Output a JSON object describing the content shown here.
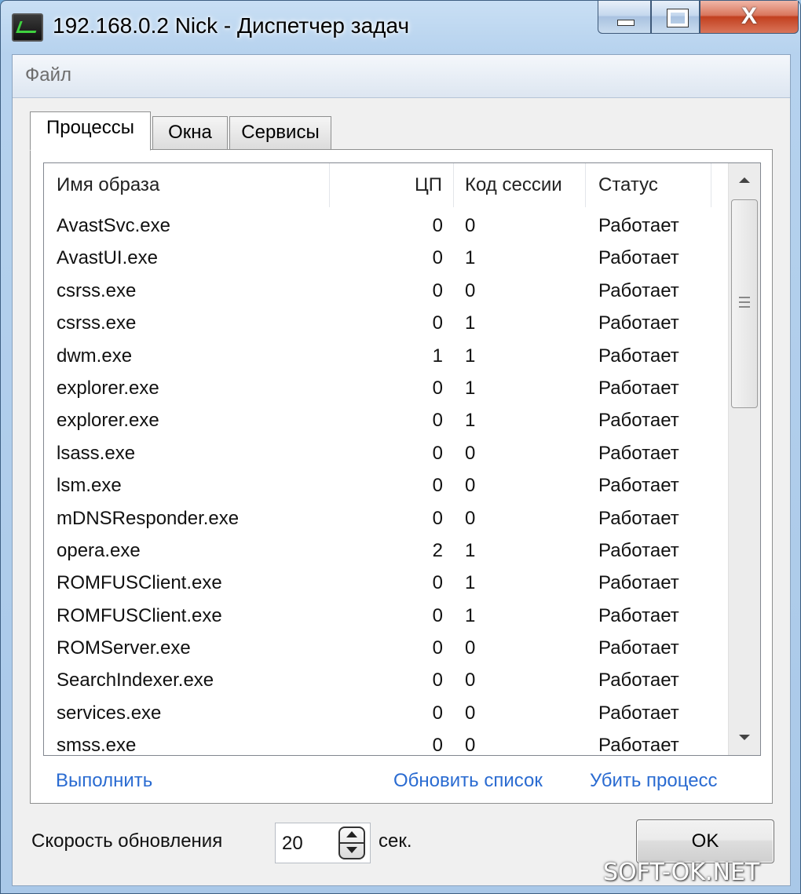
{
  "window": {
    "title": "192.168.0.2 Nick - Диспетчер задач",
    "close_glyph": "X"
  },
  "menu": {
    "file_label": "Файл"
  },
  "tabs": [
    {
      "label": "Процессы",
      "active": true
    },
    {
      "label": "Окна",
      "active": false
    },
    {
      "label": "Сервисы",
      "active": false
    }
  ],
  "table": {
    "columns": [
      "Имя образа",
      "ЦП",
      "Код сессии",
      "Статус"
    ],
    "rows": [
      {
        "name": "AvastSvc.exe",
        "cpu": "0",
        "session": "0",
        "status": "Работает"
      },
      {
        "name": "AvastUI.exe",
        "cpu": "0",
        "session": "1",
        "status": "Работает"
      },
      {
        "name": "csrss.exe",
        "cpu": "0",
        "session": "0",
        "status": "Работает"
      },
      {
        "name": "csrss.exe",
        "cpu": "0",
        "session": "1",
        "status": "Работает"
      },
      {
        "name": "dwm.exe",
        "cpu": "1",
        "session": "1",
        "status": "Работает"
      },
      {
        "name": "explorer.exe",
        "cpu": "0",
        "session": "1",
        "status": "Работает"
      },
      {
        "name": "explorer.exe",
        "cpu": "0",
        "session": "1",
        "status": "Работает"
      },
      {
        "name": "lsass.exe",
        "cpu": "0",
        "session": "0",
        "status": "Работает"
      },
      {
        "name": "lsm.exe",
        "cpu": "0",
        "session": "0",
        "status": "Работает"
      },
      {
        "name": "mDNSResponder.exe",
        "cpu": "0",
        "session": "0",
        "status": "Работает"
      },
      {
        "name": "opera.exe",
        "cpu": "2",
        "session": "1",
        "status": "Работает"
      },
      {
        "name": "ROMFUSClient.exe",
        "cpu": "0",
        "session": "1",
        "status": "Работает"
      },
      {
        "name": "ROMFUSClient.exe",
        "cpu": "0",
        "session": "1",
        "status": "Работает"
      },
      {
        "name": "ROMServer.exe",
        "cpu": "0",
        "session": "0",
        "status": "Работает"
      },
      {
        "name": "SearchIndexer.exe",
        "cpu": "0",
        "session": "0",
        "status": "Работает"
      },
      {
        "name": "services.exe",
        "cpu": "0",
        "session": "0",
        "status": "Работает"
      },
      {
        "name": "smss.exe",
        "cpu": "0",
        "session": "0",
        "status": "Работает"
      }
    ]
  },
  "actions": {
    "run": "Выполнить",
    "refresh_list": "Обновить список",
    "kill_process": "Убить процесс"
  },
  "refresh": {
    "label": "Скорость обновления",
    "value": "20",
    "unit": "сек."
  },
  "ok_button": "OK",
  "watermark": "SOFT-OK.NET",
  "colors": {
    "link": "#2a6bd1",
    "close_button": "#c2401f",
    "titlebar": "#b6d2ee"
  }
}
